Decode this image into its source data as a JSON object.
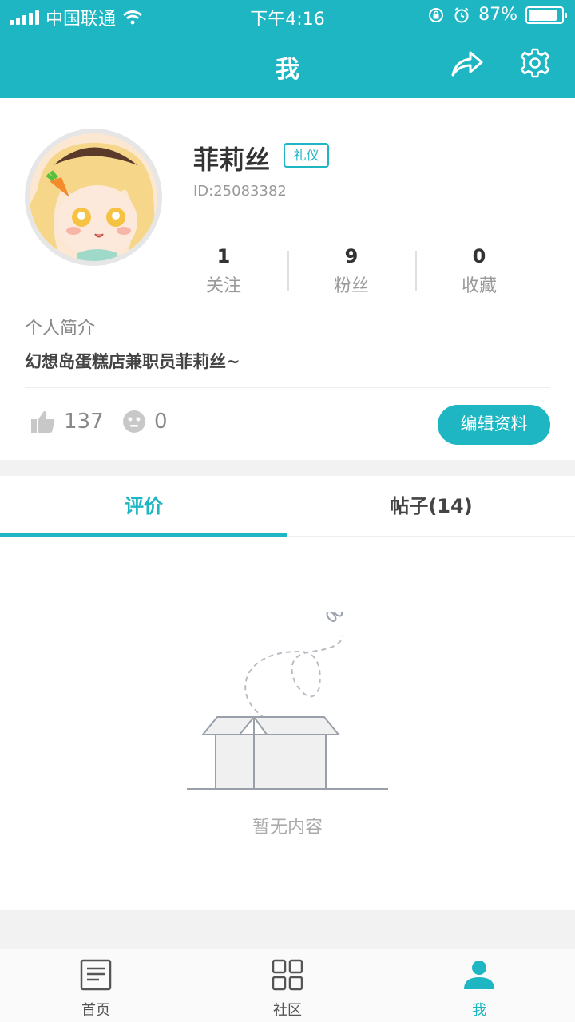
{
  "status_bar": {
    "carrier": "中国联通",
    "time": "下午4:16",
    "battery_pct": "87%"
  },
  "header": {
    "title": "我",
    "share_icon": "share-icon",
    "settings_icon": "gear-icon"
  },
  "profile": {
    "name": "菲莉丝",
    "badge": "礼仪",
    "user_id": "ID:25083382",
    "stats": [
      {
        "value": "1",
        "label": "关注"
      },
      {
        "value": "9",
        "label": "粉丝"
      },
      {
        "value": "0",
        "label": "收藏"
      }
    ],
    "bio_label": "个人简介",
    "bio": "幻想岛蛋糕店兼职员菲莉丝~",
    "likes": "137",
    "dislikes": "0",
    "edit_button": "编辑资料"
  },
  "tabs": [
    {
      "label": "评价",
      "active": true
    },
    {
      "label": "帖子(14)",
      "active": false
    }
  ],
  "empty_state": "暂无内容",
  "bottom_nav": [
    {
      "label": "首页",
      "icon": "news-icon",
      "active": false
    },
    {
      "label": "社区",
      "icon": "grid-icon",
      "active": false
    },
    {
      "label": "我",
      "icon": "person-icon",
      "active": true
    }
  ],
  "colors": {
    "accent": "#1fb6c3",
    "muted_text": "#999999"
  }
}
